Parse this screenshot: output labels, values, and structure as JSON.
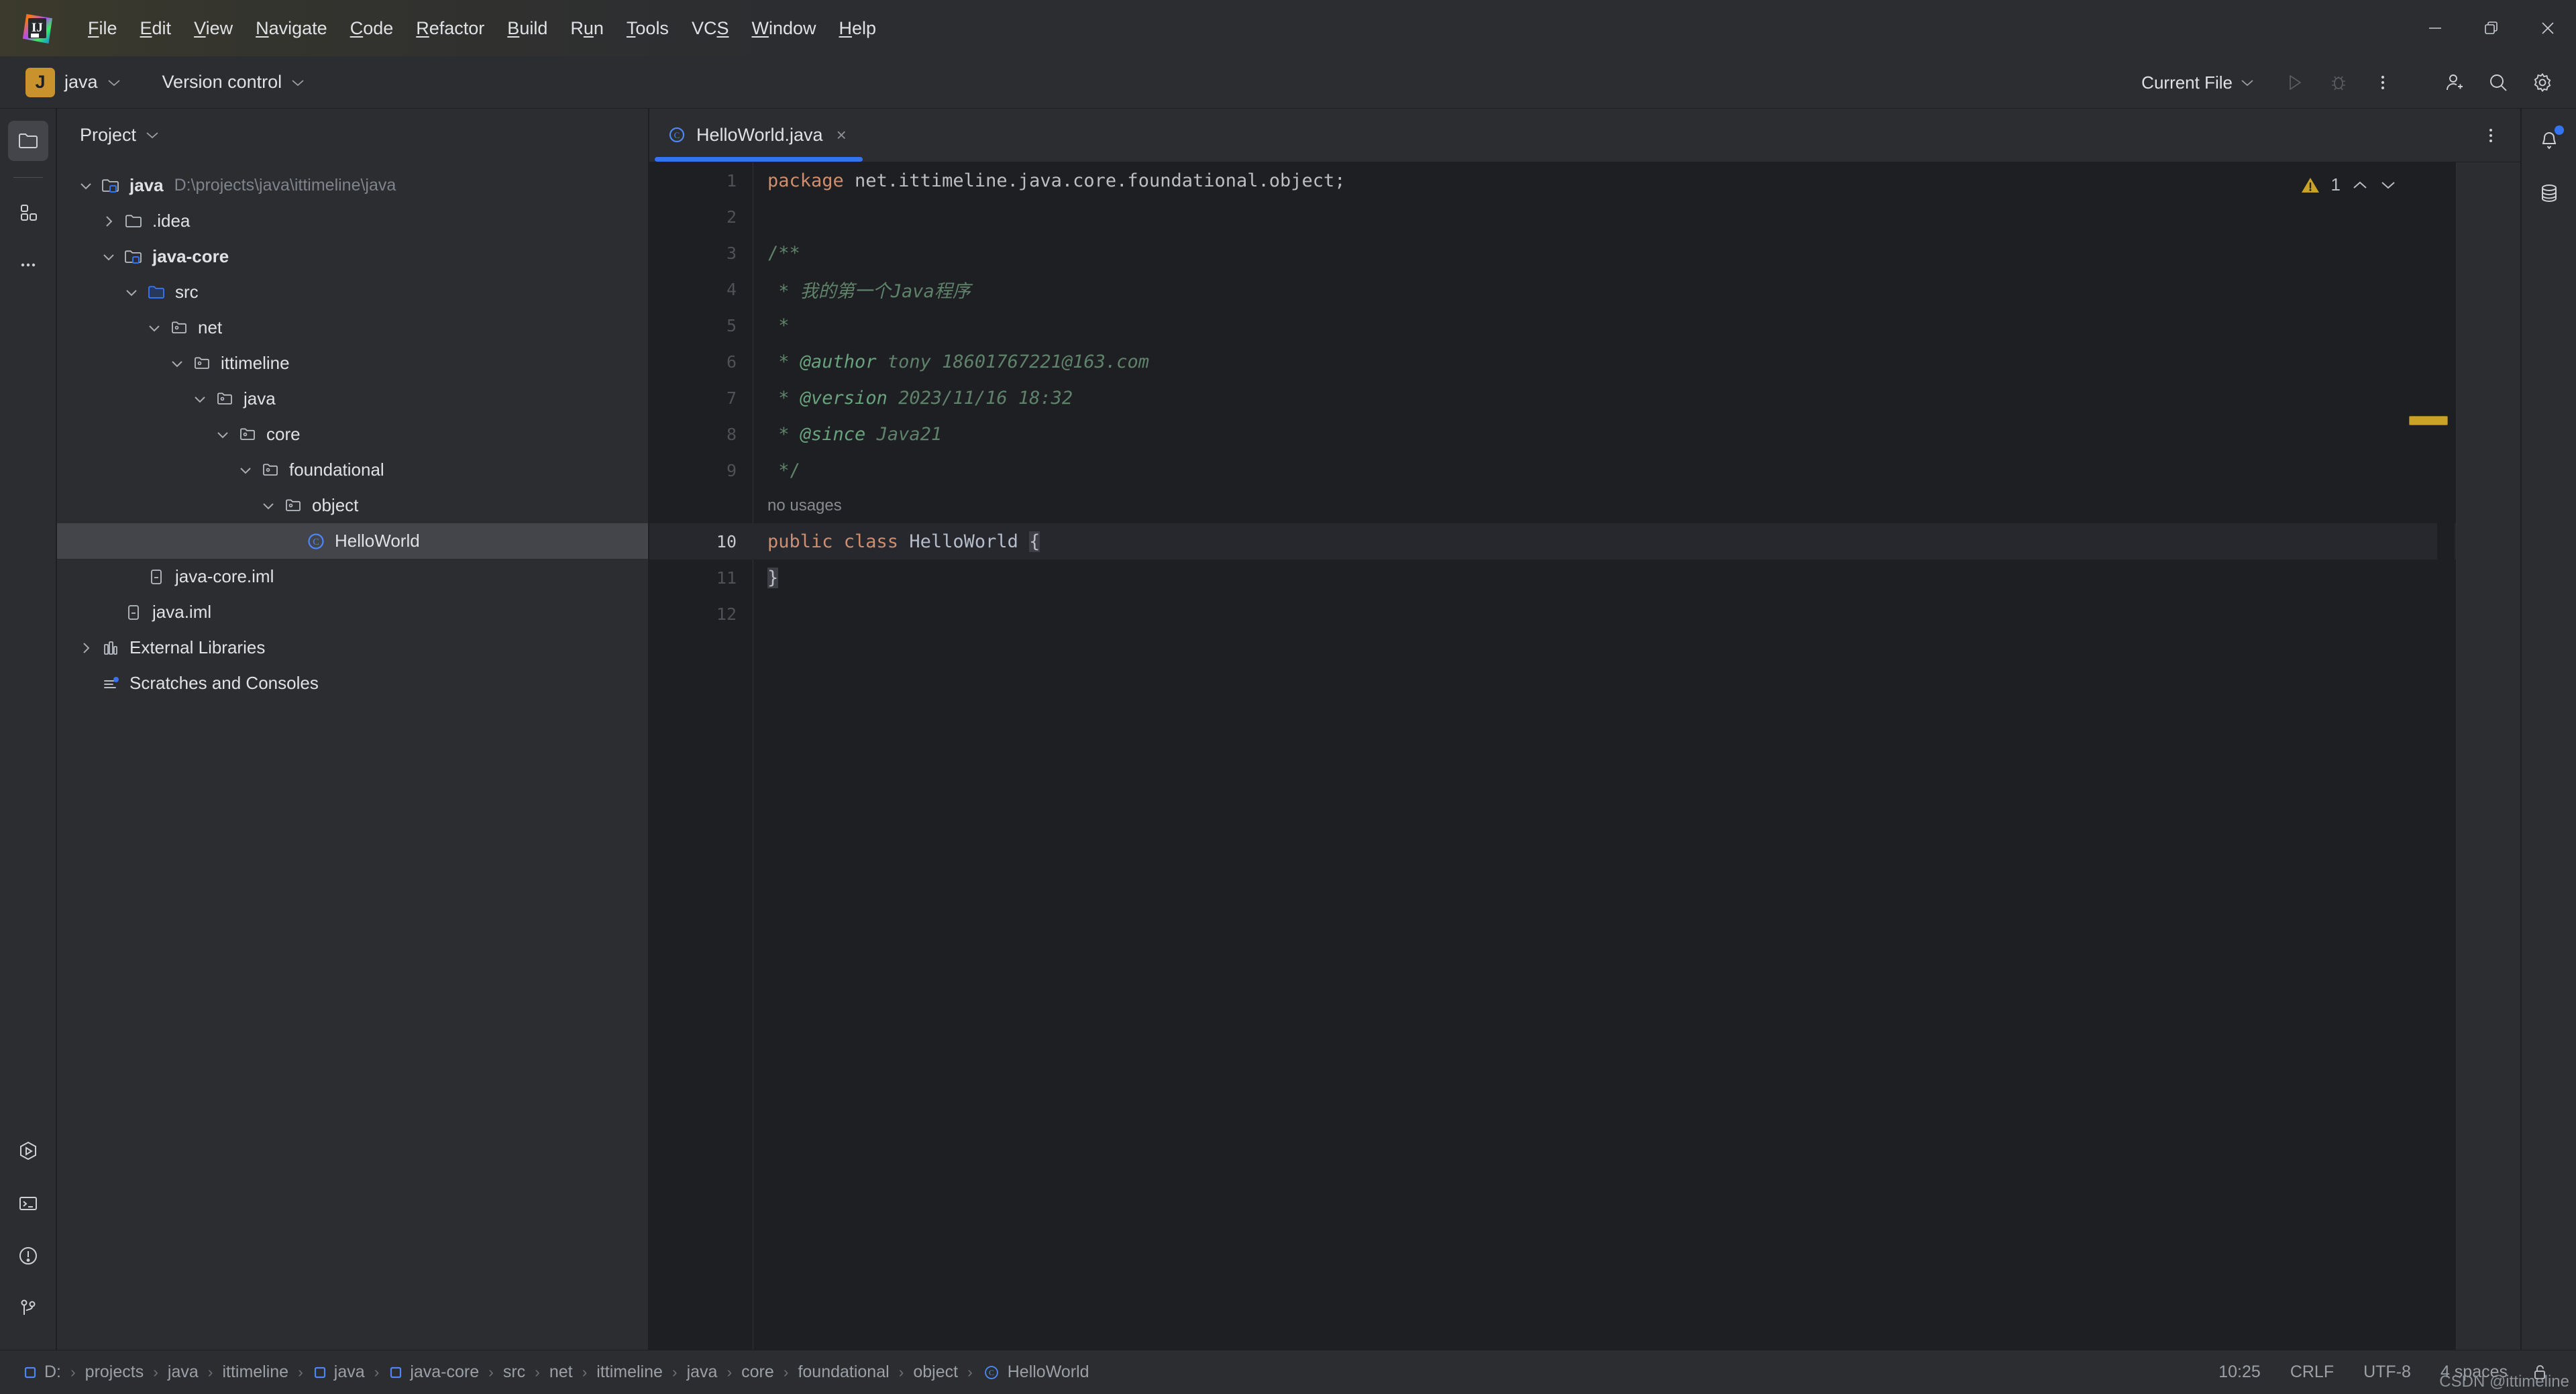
{
  "app": {
    "logo_text": "IJ",
    "menu": [
      {
        "label": "File",
        "mnemonic": "F"
      },
      {
        "label": "Edit",
        "mnemonic": "E"
      },
      {
        "label": "View",
        "mnemonic": "V"
      },
      {
        "label": "Navigate",
        "mnemonic": "N"
      },
      {
        "label": "Code",
        "mnemonic": "C"
      },
      {
        "label": "Refactor",
        "mnemonic": "R"
      },
      {
        "label": "Build",
        "mnemonic": "B"
      },
      {
        "label": "Run",
        "mnemonic": "u"
      },
      {
        "label": "Tools",
        "mnemonic": "T"
      },
      {
        "label": "VCS",
        "mnemonic": "S"
      },
      {
        "label": "Window",
        "mnemonic": "W"
      },
      {
        "label": "Help",
        "mnemonic": "H"
      }
    ],
    "window_controls": {
      "minimize": "minimize-button",
      "restore": "restore-button",
      "close": "close-button"
    }
  },
  "toolbar": {
    "project_badge": "J",
    "project_name": "java",
    "version_control": "Version control",
    "run_config": "Current File",
    "run_icon": "run-icon",
    "debug_icon": "debug-icon",
    "more_icon": "more-vertical-icon",
    "account_icon": "add-user-icon",
    "search_icon": "search-icon",
    "settings_icon": "gear-icon"
  },
  "left_stripe": {
    "top": [
      {
        "name": "project-tool-window",
        "icon": "folder-icon",
        "active": true
      },
      {
        "name": "commit-tool-window",
        "icon": "structure-icon",
        "active": false
      },
      {
        "name": "more-tool-windows",
        "icon": "ellipsis-icon",
        "active": false
      }
    ],
    "bottom": [
      {
        "name": "run-tool-window",
        "icon": "run-hexagon-icon"
      },
      {
        "name": "terminal-tool-window",
        "icon": "terminal-icon"
      },
      {
        "name": "problems-tool-window",
        "icon": "warning-circle-icon"
      },
      {
        "name": "git-tool-window",
        "icon": "git-branch-icon"
      }
    ]
  },
  "right_stripe": {
    "items": [
      {
        "name": "notifications",
        "icon": "bell-icon",
        "badge": true
      },
      {
        "name": "database-tool-window",
        "icon": "database-icon",
        "badge": false
      }
    ]
  },
  "project_panel": {
    "title": "Project",
    "tree": [
      {
        "label": "java",
        "path": "D:\\projects\\java\\ittimeline\\java",
        "icon": "module-folder-icon",
        "arrow": "expanded",
        "indent": 0,
        "bold": true,
        "selected": false
      },
      {
        "label": ".idea",
        "path": "",
        "icon": "folder-icon",
        "arrow": "collapsed",
        "indent": 1,
        "bold": false,
        "selected": false
      },
      {
        "label": "java-core",
        "path": "",
        "icon": "module-folder-icon",
        "arrow": "expanded",
        "indent": 1,
        "bold": true,
        "selected": false
      },
      {
        "label": "src",
        "path": "",
        "icon": "source-folder-icon",
        "arrow": "expanded",
        "indent": 2,
        "bold": false,
        "selected": false
      },
      {
        "label": "net",
        "path": "",
        "icon": "package-icon",
        "arrow": "expanded",
        "indent": 3,
        "bold": false,
        "selected": false
      },
      {
        "label": "ittimeline",
        "path": "",
        "icon": "package-icon",
        "arrow": "expanded",
        "indent": 4,
        "bold": false,
        "selected": false
      },
      {
        "label": "java",
        "path": "",
        "icon": "package-icon",
        "arrow": "expanded",
        "indent": 5,
        "bold": false,
        "selected": false
      },
      {
        "label": "core",
        "path": "",
        "icon": "package-icon",
        "arrow": "expanded",
        "indent": 6,
        "bold": false,
        "selected": false
      },
      {
        "label": "foundational",
        "path": "",
        "icon": "package-icon",
        "arrow": "expanded",
        "indent": 7,
        "bold": false,
        "selected": false
      },
      {
        "label": "object",
        "path": "",
        "icon": "package-icon",
        "arrow": "expanded",
        "indent": 8,
        "bold": false,
        "selected": false
      },
      {
        "label": "HelloWorld",
        "path": "",
        "icon": "java-class-icon",
        "arrow": "none",
        "indent": 9,
        "bold": false,
        "selected": true
      },
      {
        "label": "java-core.iml",
        "path": "",
        "icon": "iml-file-icon",
        "arrow": "none",
        "indent": 2,
        "bold": false,
        "selected": false
      },
      {
        "label": "java.iml",
        "path": "",
        "icon": "iml-file-icon",
        "arrow": "none",
        "indent": 1,
        "bold": false,
        "selected": false
      },
      {
        "label": "External Libraries",
        "path": "",
        "icon": "library-icon",
        "arrow": "collapsed",
        "indent": 0,
        "bold": false,
        "selected": false
      },
      {
        "label": "Scratches and Consoles",
        "path": "",
        "icon": "scratches-icon",
        "arrow": "none",
        "indent": 0,
        "bold": false,
        "selected": false
      }
    ]
  },
  "editor": {
    "tab": {
      "label": "HelloWorld.java",
      "icon": "java-class-icon",
      "close": "×"
    },
    "inspection": {
      "warning_count": "1",
      "warning_icon": "warning-triangle-icon",
      "prev": "∧",
      "next": "∨"
    },
    "more_icon": "more-vertical-icon",
    "inlay_hint": "no usages",
    "lines": [
      {
        "num": "1",
        "segments": [
          {
            "t": "package",
            "c": "kw"
          },
          {
            "t": " net.ittimeline.java.core.foundational.object;",
            "c": "plain"
          }
        ]
      },
      {
        "num": "2",
        "segments": []
      },
      {
        "num": "3",
        "segments": [
          {
            "t": "/**",
            "c": "cmt"
          }
        ]
      },
      {
        "num": "4",
        "segments": [
          {
            "t": " * ",
            "c": "cmt"
          },
          {
            "t": "我的第一个Java程序",
            "c": "cmt-i"
          }
        ]
      },
      {
        "num": "5",
        "segments": [
          {
            "t": " *",
            "c": "cmt"
          }
        ]
      },
      {
        "num": "6",
        "segments": [
          {
            "t": " * ",
            "c": "cmt"
          },
          {
            "t": "@author",
            "c": "doc-tag"
          },
          {
            "t": " tony 18601767221@163.com",
            "c": "doc-val"
          }
        ]
      },
      {
        "num": "7",
        "segments": [
          {
            "t": " * ",
            "c": "cmt"
          },
          {
            "t": "@version",
            "c": "doc-tag"
          },
          {
            "t": " 2023/11/16 18:32",
            "c": "doc-val"
          }
        ]
      },
      {
        "num": "8",
        "segments": [
          {
            "t": " * ",
            "c": "cmt"
          },
          {
            "t": "@since",
            "c": "doc-tag"
          },
          {
            "t": " Java21",
            "c": "doc-val"
          }
        ]
      },
      {
        "num": "9",
        "segments": [
          {
            "t": " */",
            "c": "cmt"
          }
        ]
      },
      {
        "num": "10",
        "current": true,
        "segments": [
          {
            "t": "public class",
            "c": "kw"
          },
          {
            "t": " ",
            "c": "plain"
          },
          {
            "t": "HelloWorld",
            "c": "cls"
          },
          {
            "t": " ",
            "c": "plain"
          },
          {
            "t": "{",
            "c": "brace-hl"
          }
        ]
      },
      {
        "num": "11",
        "segments": [
          {
            "t": "}",
            "c": "brace-hl"
          }
        ]
      },
      {
        "num": "12",
        "segments": []
      }
    ]
  },
  "statusbar": {
    "breadcrumbs": [
      {
        "label": "D:",
        "icon": "module-icon"
      },
      {
        "label": "projects",
        "icon": ""
      },
      {
        "label": "java",
        "icon": ""
      },
      {
        "label": "ittimeline",
        "icon": ""
      },
      {
        "label": "java",
        "icon": "module-icon"
      },
      {
        "label": "java-core",
        "icon": "module-icon"
      },
      {
        "label": "src",
        "icon": ""
      },
      {
        "label": "net",
        "icon": ""
      },
      {
        "label": "ittimeline",
        "icon": ""
      },
      {
        "label": "java",
        "icon": ""
      },
      {
        "label": "core",
        "icon": ""
      },
      {
        "label": "foundational",
        "icon": ""
      },
      {
        "label": "object",
        "icon": ""
      },
      {
        "label": "HelloWorld",
        "icon": "java-class-icon"
      }
    ],
    "separator": "›",
    "caret_position": "10:25",
    "line_separator": "CRLF",
    "encoding": "UTF-8",
    "indent": "4 spaces",
    "lock_icon": "unlocked-padlock-icon",
    "watermark": "CSDN @ittimeline"
  },
  "colors": {
    "accent_blue": "#3574F0",
    "badge_gold": "#C9922C",
    "warning_yellow": "#C9A227",
    "keyword_orange": "#CF8E6D",
    "comment_green": "#5F826B",
    "bg_editor": "#1e1f22",
    "bg_panel": "#2b2d30"
  }
}
